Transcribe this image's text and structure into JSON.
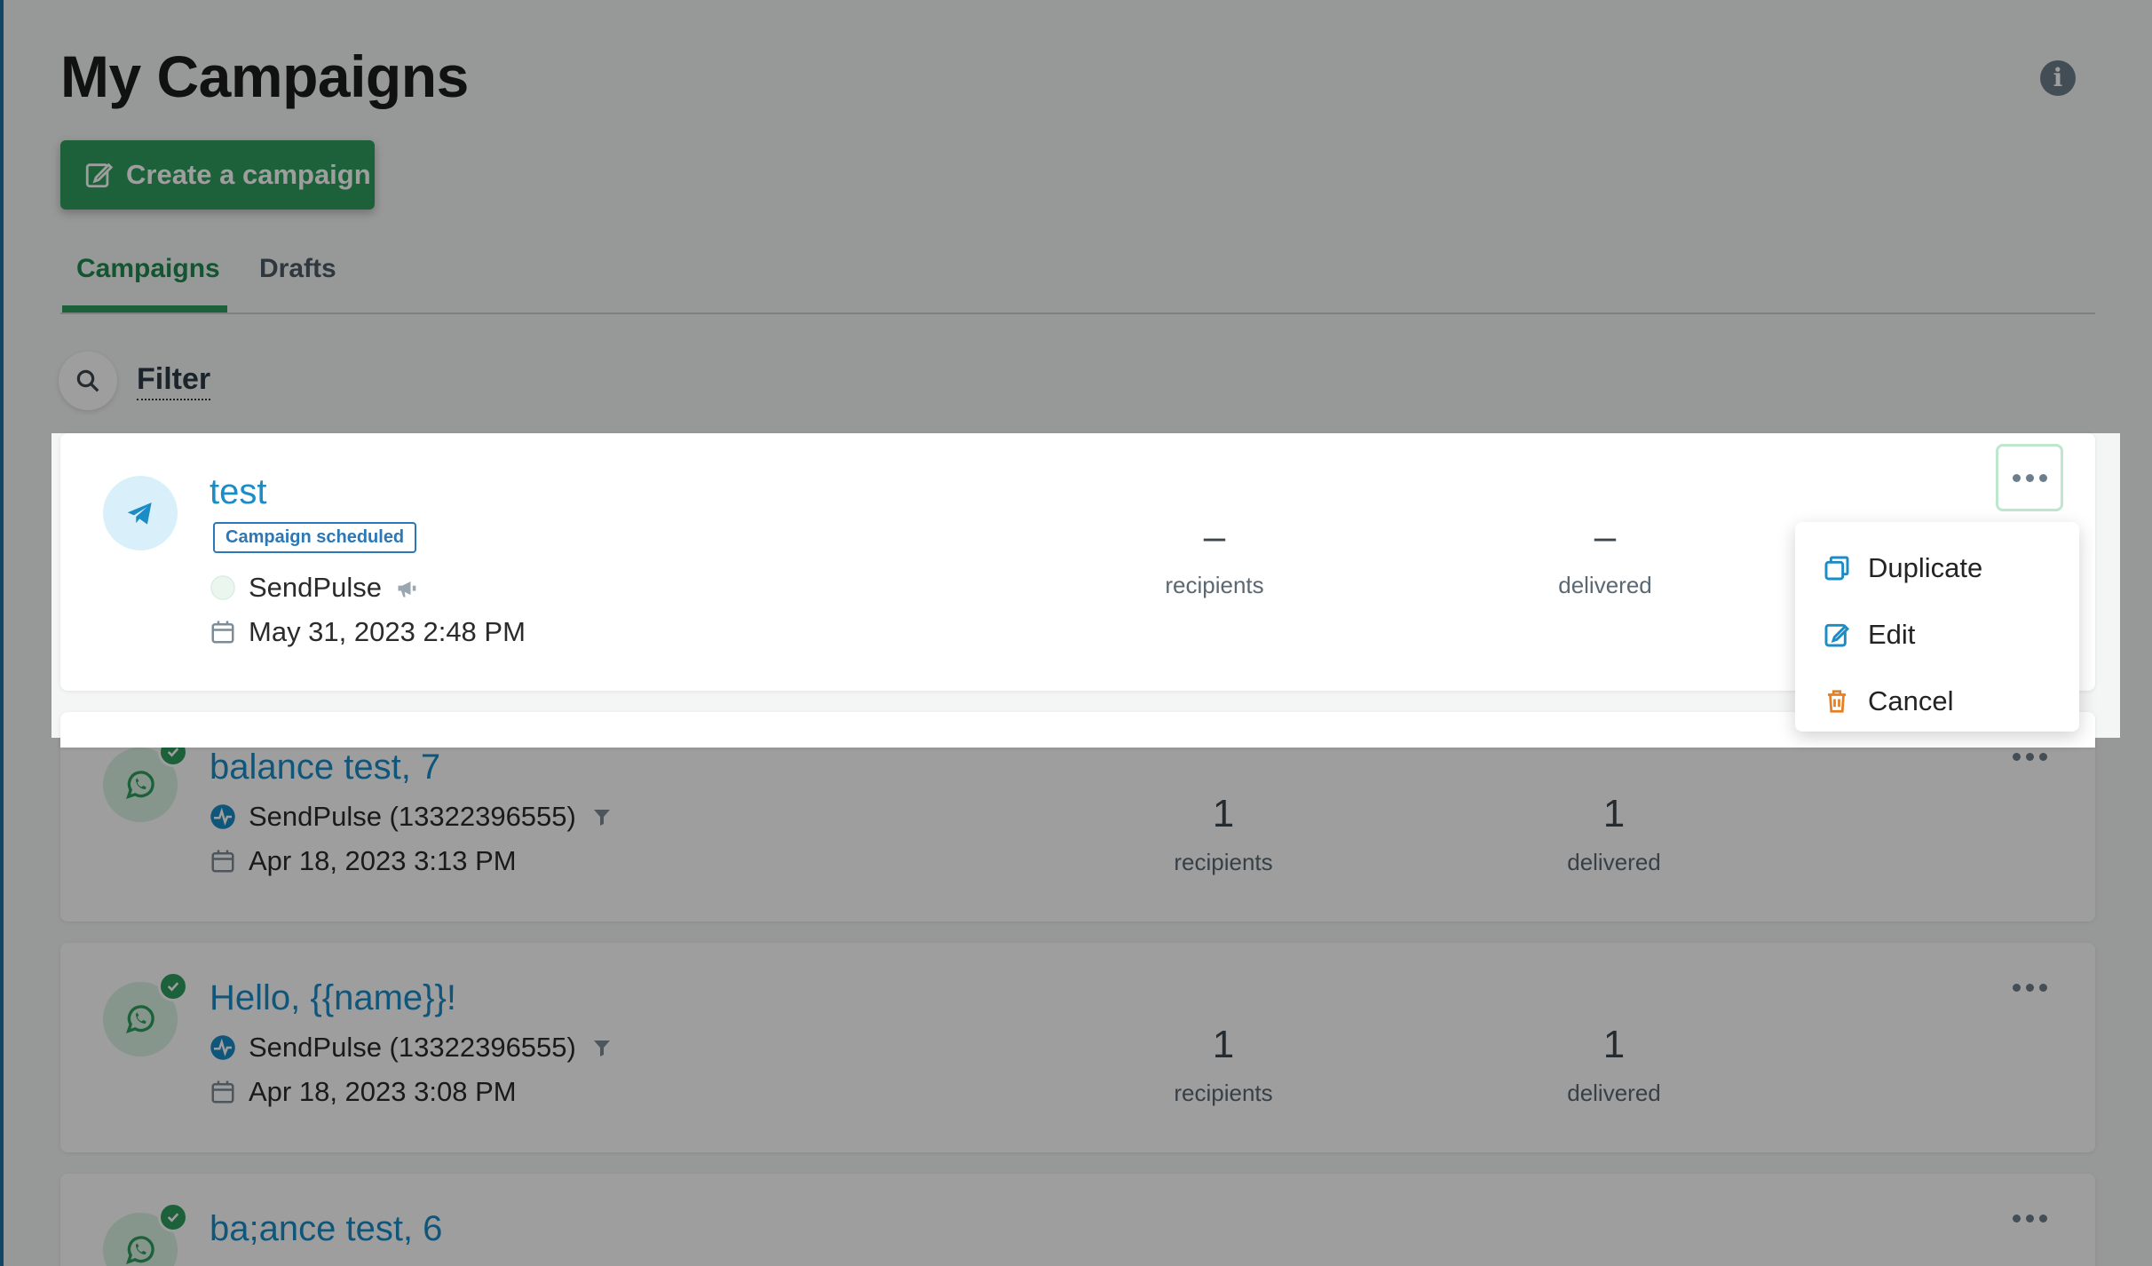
{
  "page": {
    "title": "My Campaigns",
    "create_button": "Create a campaign",
    "tabs": [
      {
        "label": "Campaigns",
        "active": true
      },
      {
        "label": "Drafts",
        "active": false
      }
    ],
    "filter_label": "Filter",
    "accent_color": "#2e9d5c",
    "link_color": "#1b8cc5"
  },
  "campaigns": [
    {
      "title": "test",
      "status": "Campaign scheduled",
      "channel_icon": "telegram-icon",
      "sender": "SendPulse",
      "sender_icon": "megaphone-icon",
      "date": "May 31, 2023 2:48 PM",
      "recipients_value": "–",
      "recipients_label": "recipients",
      "delivered_value": "–",
      "delivered_label": "delivered"
    },
    {
      "title": "balance test, 7",
      "channel_icon": "whatsapp-icon",
      "sender": "SendPulse (13322396555)",
      "sender_icon": "filter-icon",
      "date": "Apr 18, 2023 3:13 PM",
      "recipients_value": "1",
      "recipients_label": "recipients",
      "delivered_value": "1",
      "delivered_label": "delivered"
    },
    {
      "title": "Hello, {{name}}!",
      "channel_icon": "whatsapp-icon",
      "sender": "SendPulse (13322396555)",
      "sender_icon": "filter-icon",
      "date": "Apr 18, 2023 3:08 PM",
      "recipients_value": "1",
      "recipients_label": "recipients",
      "delivered_value": "1",
      "delivered_label": "delivered"
    },
    {
      "title": "ba;ance test, 6",
      "channel_icon": "whatsapp-icon"
    }
  ],
  "menu": {
    "items": [
      {
        "label": "Duplicate",
        "icon": "duplicate-icon"
      },
      {
        "label": "Edit",
        "icon": "edit-icon"
      },
      {
        "label": "Cancel",
        "icon": "trash-icon"
      }
    ]
  }
}
